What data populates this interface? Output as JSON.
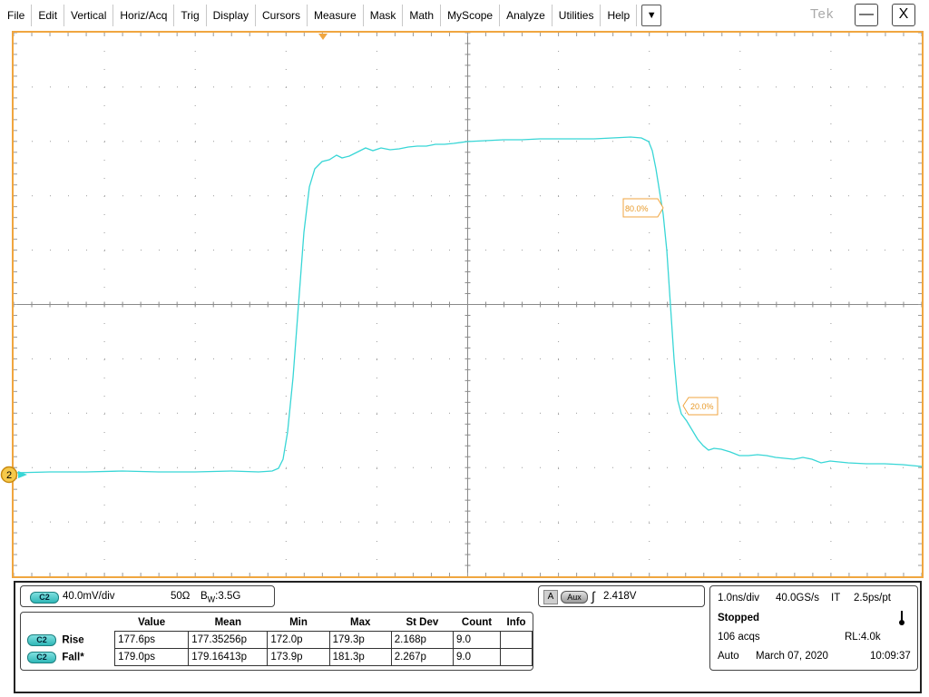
{
  "menu": {
    "items": [
      "File",
      "Edit",
      "Vertical",
      "Horiz/Acq",
      "Trig",
      "Display",
      "Cursors",
      "Measure",
      "Mask",
      "Math",
      "MyScope",
      "Analyze",
      "Utilities",
      "Help"
    ],
    "dropdown_glyph": "▼",
    "brand": "Tek",
    "minimize_glyph": "—",
    "close_glyph": "X"
  },
  "display": {
    "channel_marker": "2",
    "label_80": "80.0%",
    "label_20": "20.0%",
    "trace_color": "#38d6d6",
    "frame_color": "#f0a640",
    "grid_color": "#999999"
  },
  "channel": {
    "badge": "C2",
    "scale": "40.0mV/div",
    "impedance": "50Ω",
    "bandwidth_prefix": "B",
    "bandwidth_sub": "W",
    "bandwidth_value": ":3.5G"
  },
  "trigger": {
    "source_box": "A",
    "source": "Aux",
    "slope_glyph": "∫",
    "level": "2.418V"
  },
  "measurements": {
    "headers": [
      "Value",
      "Mean",
      "Min",
      "Max",
      "St Dev",
      "Count",
      "Info"
    ],
    "rows": [
      {
        "badge": "C2",
        "name": "Rise",
        "value": "177.6ps",
        "mean": "177.35256p",
        "min": "172.0p",
        "max": "179.3p",
        "stdev": "2.168p",
        "count": "9.0",
        "info": ""
      },
      {
        "badge": "C2",
        "name": "Fall*",
        "value": "179.0ps",
        "mean": "179.16413p",
        "min": "173.9p",
        "max": "181.3p",
        "stdev": "2.267p",
        "count": "9.0",
        "info": ""
      }
    ]
  },
  "acquisition": {
    "timebase": "1.0ns/div",
    "sample_rate": "40.0GS/s",
    "mode": "IT",
    "resolution": "2.5ps/pt",
    "state": "Stopped",
    "acqs": "106 acqs",
    "record_length": "RL:4.0k",
    "trigger_mode": "Auto",
    "date": "March 07, 2020",
    "time": "10:09:37"
  }
}
